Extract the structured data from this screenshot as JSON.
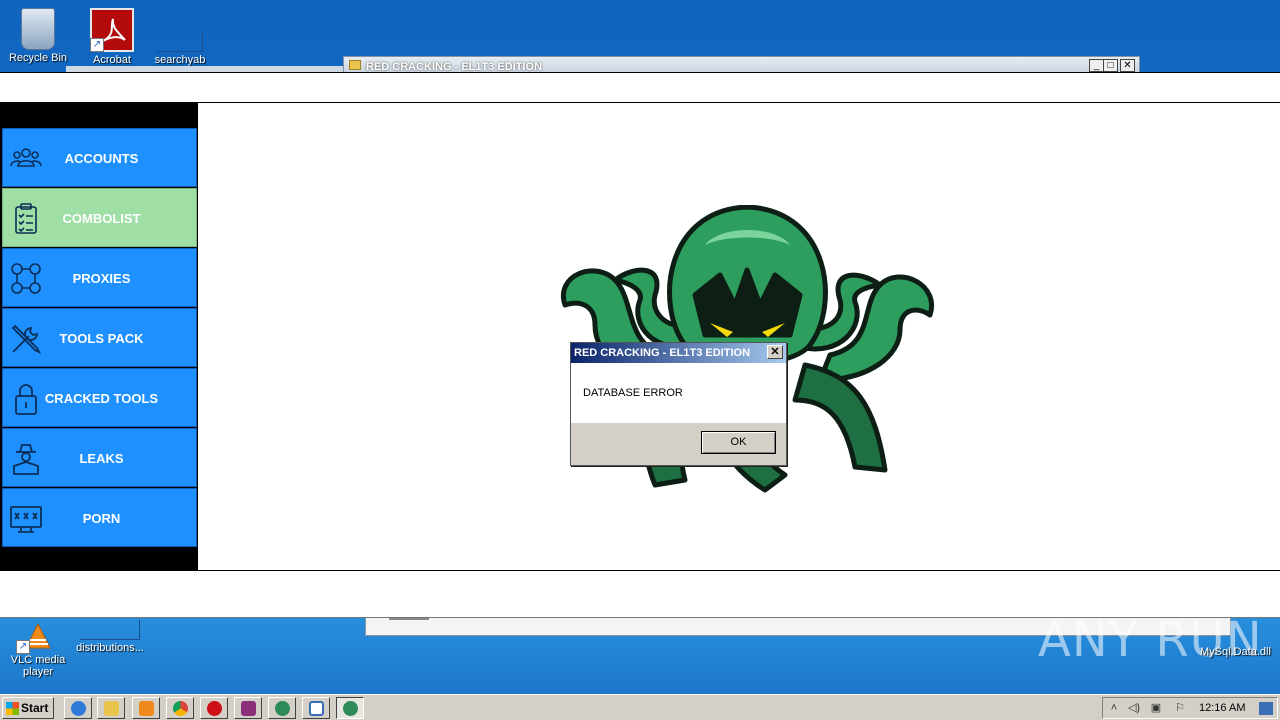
{
  "desktop": {
    "icons_top": [
      {
        "label": "Recycle Bin",
        "icon": "recycle-bin-icon"
      },
      {
        "label": "Acrobat",
        "icon": "acrobat-icon"
      },
      {
        "label": "searchyab",
        "icon": "shortcut-icon"
      }
    ],
    "icons_bottom": [
      {
        "label": "VLC media player",
        "icon": "vlc-icon"
      },
      {
        "label": "distributions...",
        "icon": "file-icon"
      }
    ],
    "dll_label": "MySql.Data.dll",
    "watermark": "ANY RUN"
  },
  "background_window": {
    "title": "RED CRACKING - EL1T3 EDITION",
    "buttons": {
      "minimize": "_",
      "maximize": "□",
      "close": "✕"
    }
  },
  "sidebar": {
    "items": [
      {
        "label": "ACCOUNTS",
        "icon": "people-icon",
        "active": false
      },
      {
        "label": "COMBOLIST",
        "icon": "clipboard-checklist-icon",
        "active": true
      },
      {
        "label": "PROXIES",
        "icon": "network-nodes-icon",
        "active": false
      },
      {
        "label": "TOOLS PACK",
        "icon": "wrench-screwdriver-icon",
        "active": false
      },
      {
        "label": "CRACKED TOOLS",
        "icon": "padlock-icon",
        "active": false
      },
      {
        "label": "LEAKS",
        "icon": "hacker-icon",
        "active": false
      },
      {
        "label": "PORN",
        "icon": "xxx-monitor-icon",
        "active": false
      }
    ]
  },
  "dialog": {
    "title": "RED CRACKING - EL1T3 EDITION",
    "close": "✕",
    "message": "DATABASE ERROR",
    "ok_label": "OK"
  },
  "taskbar": {
    "start_label": "Start",
    "clock": "12:16 AM",
    "buttons": [
      {
        "icon": "ie-icon",
        "color": "#2f7ad8"
      },
      {
        "icon": "folder-icon",
        "color": "#e8c44d"
      },
      {
        "icon": "media-player-icon",
        "color": "#f08a1c"
      },
      {
        "icon": "chrome-icon",
        "color": "#db4437"
      },
      {
        "icon": "opera-icon",
        "color": "#cc1016"
      },
      {
        "icon": "winrar-icon",
        "color": "#8b2f7a"
      },
      {
        "icon": "octopus-app-icon",
        "color": "#2e8b57"
      },
      {
        "icon": "window-icon",
        "color": "#3a6fb6"
      },
      {
        "icon": "octopus-app-active-icon",
        "color": "#2e8b57"
      }
    ]
  },
  "colors": {
    "menu_button": "#1e90ff",
    "menu_active": "#9fdfa5",
    "mascot_green": "#2e9e5e"
  }
}
